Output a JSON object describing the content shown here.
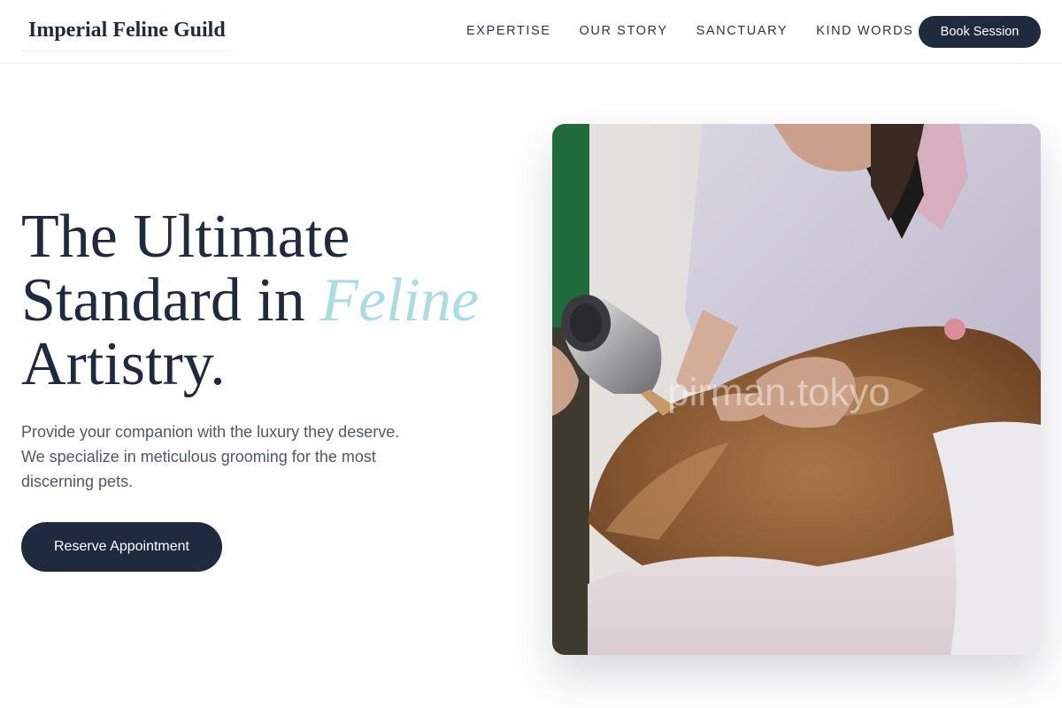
{
  "brand": {
    "name": "Imperial Feline Guild"
  },
  "nav": {
    "links": [
      "EXPERTISE",
      "OUR STORY",
      "SANCTUARY",
      "KIND WORDS"
    ],
    "cta_label": "Book Session"
  },
  "hero": {
    "title_line1": "The Ultimate",
    "title_line2_prefix": "Standard in ",
    "title_accent": "Feline",
    "title_line3": "Artistry.",
    "subtitle": "Provide your companion with the luxury they deserve. We specialize in meticulous grooming for the most discerning pets.",
    "cta_label": "Reserve Appointment",
    "image_watermark": "pirman.tokyo"
  },
  "colors": {
    "primary": "#1f2a3e",
    "accent": "#a9dde2",
    "body_text": "#4f5866"
  }
}
